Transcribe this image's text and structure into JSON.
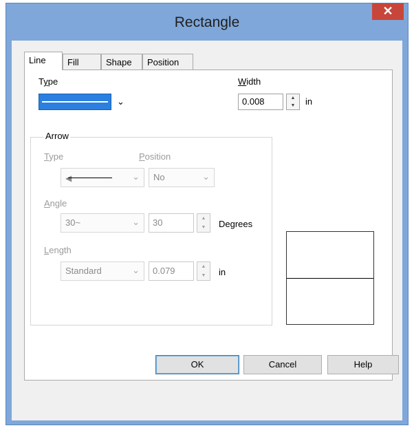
{
  "window": {
    "title": "Rectangle",
    "close_glyph": "✕"
  },
  "tabs": [
    {
      "label": "Line",
      "active": true
    },
    {
      "label": "Fill",
      "active": false
    },
    {
      "label": "Shape",
      "active": false
    },
    {
      "label": "Position",
      "active": false
    }
  ],
  "line": {
    "type_label": "Type",
    "type_accel": "y",
    "width_label": "Width",
    "width_accel": "W",
    "width_value": "0.008",
    "width_unit": "in"
  },
  "arrow": {
    "group_label": "Arrow",
    "type_label": "Type",
    "position_label": "Position",
    "position_value": "No",
    "angle_label": "Angle",
    "angle_select_value": "30~",
    "angle_value": "30",
    "angle_unit": "Degrees",
    "length_label": "Length",
    "length_select_value": "Standard",
    "length_value": "0.079",
    "length_unit": "in"
  },
  "buttons": {
    "ok": "OK",
    "cancel": "Cancel",
    "help": "Help"
  },
  "icons": {
    "dropdown": "chevron-down-icon",
    "spin_up": "spin-up-icon",
    "spin_down": "spin-down-icon"
  },
  "colors": {
    "line_sample": "#2a7fe0",
    "title_bar": "#7fa7d9",
    "close_button": "#c8453a"
  }
}
